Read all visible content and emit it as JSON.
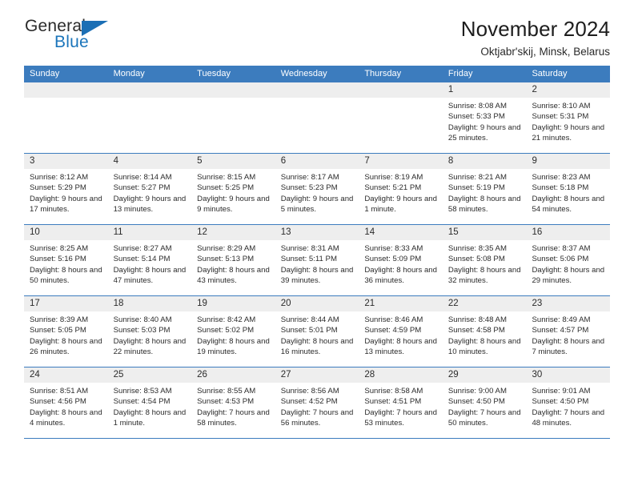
{
  "brand": {
    "name_part1": "General",
    "name_part2": "Blue"
  },
  "header": {
    "title": "November 2024",
    "subtitle": "Oktjabr'skij, Minsk, Belarus"
  },
  "colors": {
    "header_blue": "#3c7cbe",
    "brand_blue": "#1b75bb",
    "day_strip_gray": "#eeeeee",
    "text": "#2b2b2b"
  },
  "weekdays": [
    "Sunday",
    "Monday",
    "Tuesday",
    "Wednesday",
    "Thursday",
    "Friday",
    "Saturday"
  ],
  "weeks": [
    [
      {
        "day": "",
        "sunrise": "",
        "sunset": "",
        "daylight": "",
        "empty": true
      },
      {
        "day": "",
        "sunrise": "",
        "sunset": "",
        "daylight": "",
        "empty": true
      },
      {
        "day": "",
        "sunrise": "",
        "sunset": "",
        "daylight": "",
        "empty": true
      },
      {
        "day": "",
        "sunrise": "",
        "sunset": "",
        "daylight": "",
        "empty": true
      },
      {
        "day": "",
        "sunrise": "",
        "sunset": "",
        "daylight": "",
        "empty": true
      },
      {
        "day": "1",
        "sunrise": "Sunrise: 8:08 AM",
        "sunset": "Sunset: 5:33 PM",
        "daylight": "Daylight: 9 hours and 25 minutes.",
        "empty": false
      },
      {
        "day": "2",
        "sunrise": "Sunrise: 8:10 AM",
        "sunset": "Sunset: 5:31 PM",
        "daylight": "Daylight: 9 hours and 21 minutes.",
        "empty": false
      }
    ],
    [
      {
        "day": "3",
        "sunrise": "Sunrise: 8:12 AM",
        "sunset": "Sunset: 5:29 PM",
        "daylight": "Daylight: 9 hours and 17 minutes.",
        "empty": false
      },
      {
        "day": "4",
        "sunrise": "Sunrise: 8:14 AM",
        "sunset": "Sunset: 5:27 PM",
        "daylight": "Daylight: 9 hours and 13 minutes.",
        "empty": false
      },
      {
        "day": "5",
        "sunrise": "Sunrise: 8:15 AM",
        "sunset": "Sunset: 5:25 PM",
        "daylight": "Daylight: 9 hours and 9 minutes.",
        "empty": false
      },
      {
        "day": "6",
        "sunrise": "Sunrise: 8:17 AM",
        "sunset": "Sunset: 5:23 PM",
        "daylight": "Daylight: 9 hours and 5 minutes.",
        "empty": false
      },
      {
        "day": "7",
        "sunrise": "Sunrise: 8:19 AM",
        "sunset": "Sunset: 5:21 PM",
        "daylight": "Daylight: 9 hours and 1 minute.",
        "empty": false
      },
      {
        "day": "8",
        "sunrise": "Sunrise: 8:21 AM",
        "sunset": "Sunset: 5:19 PM",
        "daylight": "Daylight: 8 hours and 58 minutes.",
        "empty": false
      },
      {
        "day": "9",
        "sunrise": "Sunrise: 8:23 AM",
        "sunset": "Sunset: 5:18 PM",
        "daylight": "Daylight: 8 hours and 54 minutes.",
        "empty": false
      }
    ],
    [
      {
        "day": "10",
        "sunrise": "Sunrise: 8:25 AM",
        "sunset": "Sunset: 5:16 PM",
        "daylight": "Daylight: 8 hours and 50 minutes.",
        "empty": false
      },
      {
        "day": "11",
        "sunrise": "Sunrise: 8:27 AM",
        "sunset": "Sunset: 5:14 PM",
        "daylight": "Daylight: 8 hours and 47 minutes.",
        "empty": false
      },
      {
        "day": "12",
        "sunrise": "Sunrise: 8:29 AM",
        "sunset": "Sunset: 5:13 PM",
        "daylight": "Daylight: 8 hours and 43 minutes.",
        "empty": false
      },
      {
        "day": "13",
        "sunrise": "Sunrise: 8:31 AM",
        "sunset": "Sunset: 5:11 PM",
        "daylight": "Daylight: 8 hours and 39 minutes.",
        "empty": false
      },
      {
        "day": "14",
        "sunrise": "Sunrise: 8:33 AM",
        "sunset": "Sunset: 5:09 PM",
        "daylight": "Daylight: 8 hours and 36 minutes.",
        "empty": false
      },
      {
        "day": "15",
        "sunrise": "Sunrise: 8:35 AM",
        "sunset": "Sunset: 5:08 PM",
        "daylight": "Daylight: 8 hours and 32 minutes.",
        "empty": false
      },
      {
        "day": "16",
        "sunrise": "Sunrise: 8:37 AM",
        "sunset": "Sunset: 5:06 PM",
        "daylight": "Daylight: 8 hours and 29 minutes.",
        "empty": false
      }
    ],
    [
      {
        "day": "17",
        "sunrise": "Sunrise: 8:39 AM",
        "sunset": "Sunset: 5:05 PM",
        "daylight": "Daylight: 8 hours and 26 minutes.",
        "empty": false
      },
      {
        "day": "18",
        "sunrise": "Sunrise: 8:40 AM",
        "sunset": "Sunset: 5:03 PM",
        "daylight": "Daylight: 8 hours and 22 minutes.",
        "empty": false
      },
      {
        "day": "19",
        "sunrise": "Sunrise: 8:42 AM",
        "sunset": "Sunset: 5:02 PM",
        "daylight": "Daylight: 8 hours and 19 minutes.",
        "empty": false
      },
      {
        "day": "20",
        "sunrise": "Sunrise: 8:44 AM",
        "sunset": "Sunset: 5:01 PM",
        "daylight": "Daylight: 8 hours and 16 minutes.",
        "empty": false
      },
      {
        "day": "21",
        "sunrise": "Sunrise: 8:46 AM",
        "sunset": "Sunset: 4:59 PM",
        "daylight": "Daylight: 8 hours and 13 minutes.",
        "empty": false
      },
      {
        "day": "22",
        "sunrise": "Sunrise: 8:48 AM",
        "sunset": "Sunset: 4:58 PM",
        "daylight": "Daylight: 8 hours and 10 minutes.",
        "empty": false
      },
      {
        "day": "23",
        "sunrise": "Sunrise: 8:49 AM",
        "sunset": "Sunset: 4:57 PM",
        "daylight": "Daylight: 8 hours and 7 minutes.",
        "empty": false
      }
    ],
    [
      {
        "day": "24",
        "sunrise": "Sunrise: 8:51 AM",
        "sunset": "Sunset: 4:56 PM",
        "daylight": "Daylight: 8 hours and 4 minutes.",
        "empty": false
      },
      {
        "day": "25",
        "sunrise": "Sunrise: 8:53 AM",
        "sunset": "Sunset: 4:54 PM",
        "daylight": "Daylight: 8 hours and 1 minute.",
        "empty": false
      },
      {
        "day": "26",
        "sunrise": "Sunrise: 8:55 AM",
        "sunset": "Sunset: 4:53 PM",
        "daylight": "Daylight: 7 hours and 58 minutes.",
        "empty": false
      },
      {
        "day": "27",
        "sunrise": "Sunrise: 8:56 AM",
        "sunset": "Sunset: 4:52 PM",
        "daylight": "Daylight: 7 hours and 56 minutes.",
        "empty": false
      },
      {
        "day": "28",
        "sunrise": "Sunrise: 8:58 AM",
        "sunset": "Sunset: 4:51 PM",
        "daylight": "Daylight: 7 hours and 53 minutes.",
        "empty": false
      },
      {
        "day": "29",
        "sunrise": "Sunrise: 9:00 AM",
        "sunset": "Sunset: 4:50 PM",
        "daylight": "Daylight: 7 hours and 50 minutes.",
        "empty": false
      },
      {
        "day": "30",
        "sunrise": "Sunrise: 9:01 AM",
        "sunset": "Sunset: 4:50 PM",
        "daylight": "Daylight: 7 hours and 48 minutes.",
        "empty": false
      }
    ]
  ]
}
